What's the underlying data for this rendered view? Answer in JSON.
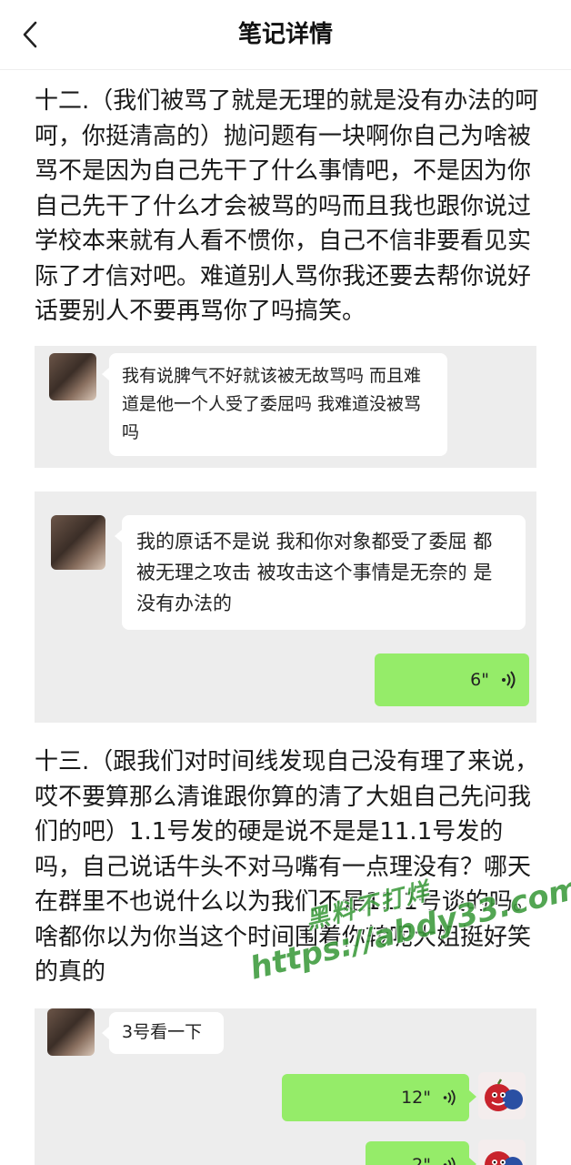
{
  "header": {
    "title": "笔记详情",
    "back_icon": "chevron-left-icon"
  },
  "paragraphs": {
    "p12": "十二.（我们被骂了就是无理的就是没有办法的呵呵，你挺清高的）抛问题有一块啊你自己为啥被骂不是因为自己先干了什么事情吧，不是因为你自己先干了什么才会被骂的吗而且我也跟你说过学校本来就有人看不惯你，自己不信非要看见实际了才信对吧。难道别人骂你我还要去帮你说好话要别人不要再骂你了吗搞笑。",
    "p13": "十三.（跟我们对时间线发现自己没有理了来说，哎不要算那么清谁跟你算的清了大姐自己先问我们的吧）1.1号发的硬是说不是是11.1号发的吗，自己说话牛头不对马嘴有一点理没有？哪天在群里不也说什么以为我们不是11.1号谈的吗。啥都你以为你当这个时间围着你转呢大姐挺好笑的真的"
  },
  "shot1": {
    "bubble": "我有说脾气不好就该被无故骂吗 而且难道是他一个人受了委屈吗 我难道没被骂吗"
  },
  "shot2": {
    "bubble": "我的原话不是说 我和你对象都受了委屈 都被无理之攻击 被攻击这个事情是无奈的 是没有办法的",
    "voice": "6\""
  },
  "shot3": {
    "bubble": "3号看一下",
    "voice1": "12\"",
    "voice2": "2\""
  },
  "watermark": {
    "line1": "黑料不打烊",
    "line2": "https://abdy33.com"
  },
  "colors": {
    "voice_green": "#95ec69",
    "chat_bg": "#ededed",
    "watermark_green": "#3c9a3c"
  }
}
